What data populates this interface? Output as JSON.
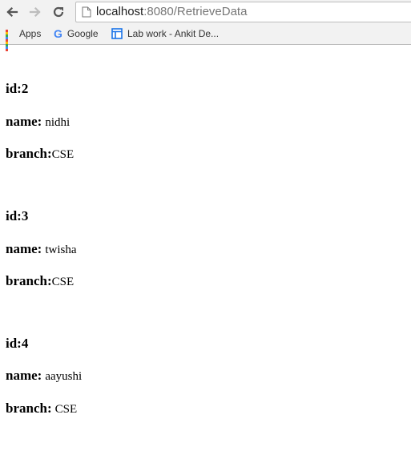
{
  "browser": {
    "url_host": "localhost",
    "url_rest": ":8080/RetrieveData",
    "bookmarks": [
      "Apps",
      "Google",
      "Lab work - Ankit De..."
    ]
  },
  "labels": {
    "id": "id:",
    "name": "name:",
    "branch": "branch:"
  },
  "records": [
    {
      "id": "2",
      "name": "nidhi",
      "branch": "CSE"
    },
    {
      "id": "3",
      "name": "twisha",
      "branch": "CSE"
    },
    {
      "id": "4",
      "name": "aayushi",
      "branch": "CSE"
    }
  ],
  "colors": {
    "apps_grid": [
      "#ea4335",
      "#fbbc05",
      "#34a853",
      "#4285f4",
      "#ea4335",
      "#fbbc05",
      "#34a853",
      "#4285f4",
      "#ea4335"
    ],
    "lab_icon": "#1a73e8"
  }
}
